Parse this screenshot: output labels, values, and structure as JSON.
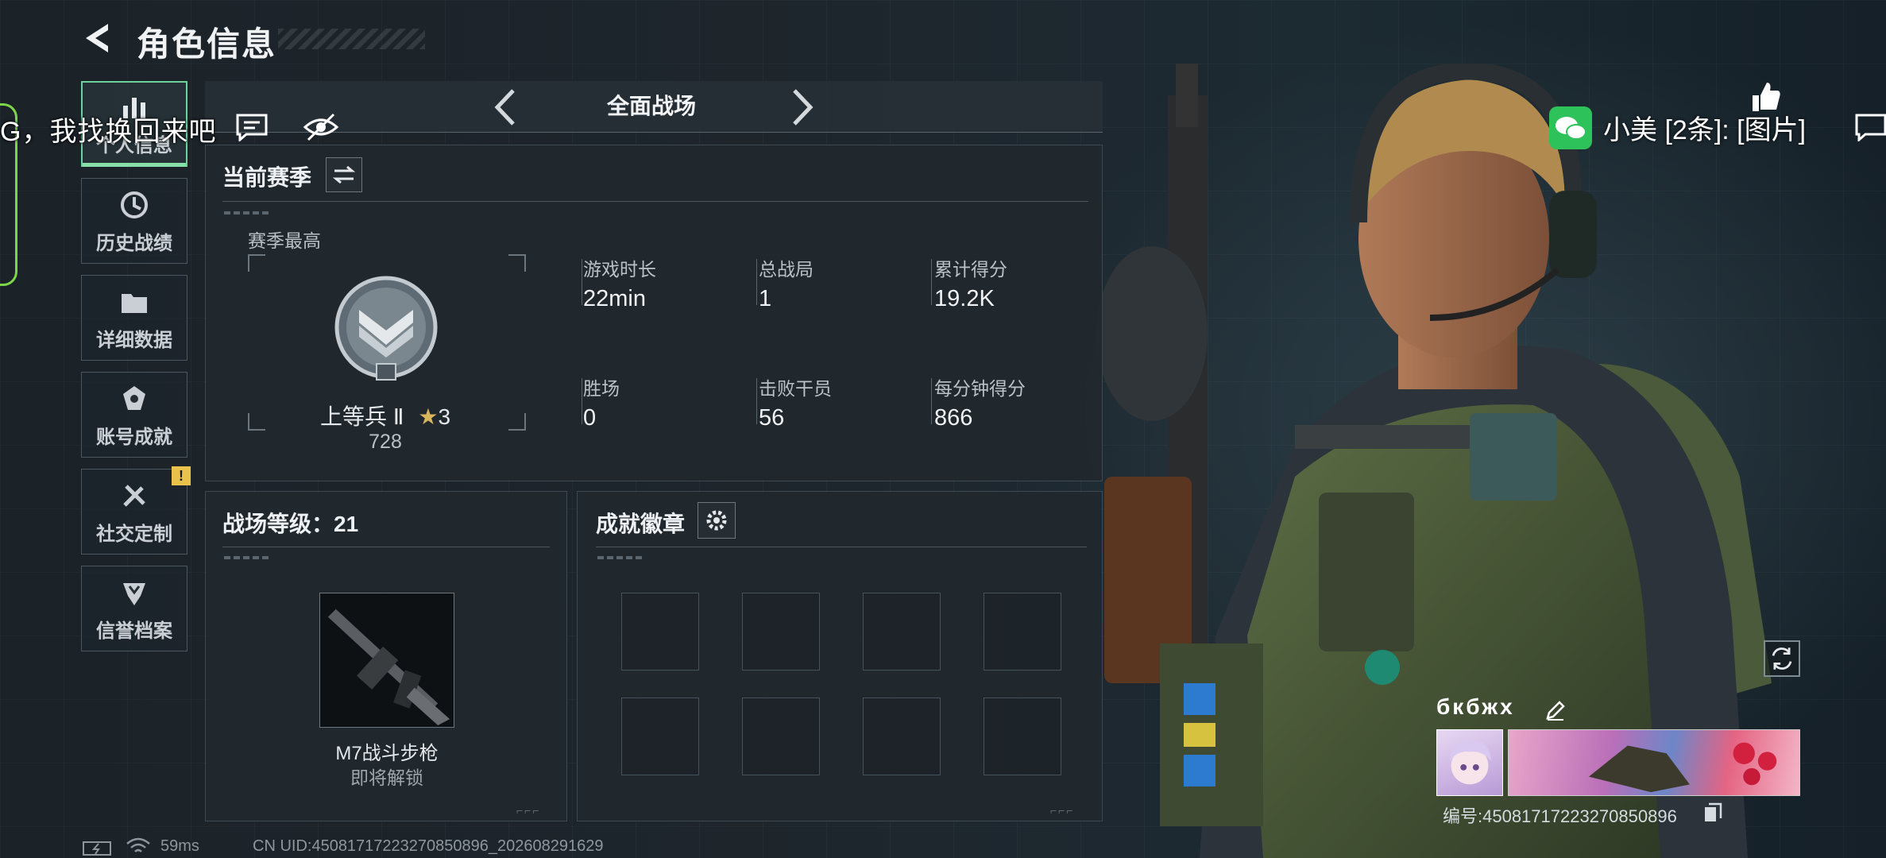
{
  "header": {
    "title": "角色信息"
  },
  "nav": [
    {
      "label": "个人信息",
      "icon": "bar-chart-icon",
      "active": true
    },
    {
      "label": "历史战绩",
      "icon": "history-icon"
    },
    {
      "label": "详细数据",
      "icon": "folder-icon"
    },
    {
      "label": "账号成就",
      "icon": "achievement-icon"
    },
    {
      "label": "社交定制",
      "icon": "tools-icon",
      "badge": "!"
    },
    {
      "label": "信誉档案",
      "icon": "shield-icon"
    }
  ],
  "overlay": {
    "chat_text": "G，我找换回来吧"
  },
  "mode": {
    "title": "全面战场"
  },
  "season": {
    "header": "当前赛季",
    "sub": "赛季最高",
    "rank_name": "上等兵 Ⅱ",
    "rank_stars": "3",
    "rank_score": "728",
    "stats": [
      {
        "label": "游戏时长",
        "value": "22min"
      },
      {
        "label": "总战局",
        "value": "1"
      },
      {
        "label": "累计得分",
        "value": "19.2K"
      },
      {
        "label": "胜场",
        "value": "0"
      },
      {
        "label": "击败干员",
        "value": "56"
      },
      {
        "label": "每分钟得分",
        "value": "866"
      }
    ]
  },
  "battlefield": {
    "header": "战场等级：21",
    "weapon_name": "M7战斗步枪",
    "weapon_status": "即将解锁"
  },
  "achievements": {
    "header": "成就徽章"
  },
  "footer": {
    "ping": "59ms",
    "uid": "CN UID:4508171722327085​0896_202608291629"
  },
  "notification": {
    "text": "小美 [2条]: [图片]"
  },
  "profile": {
    "name": "бкбжх",
    "number": "编号:4508171722327085​0896"
  },
  "colors": {
    "accent": "#86e0a8",
    "warning": "#e8c24a",
    "wechat": "#2ec25a"
  }
}
